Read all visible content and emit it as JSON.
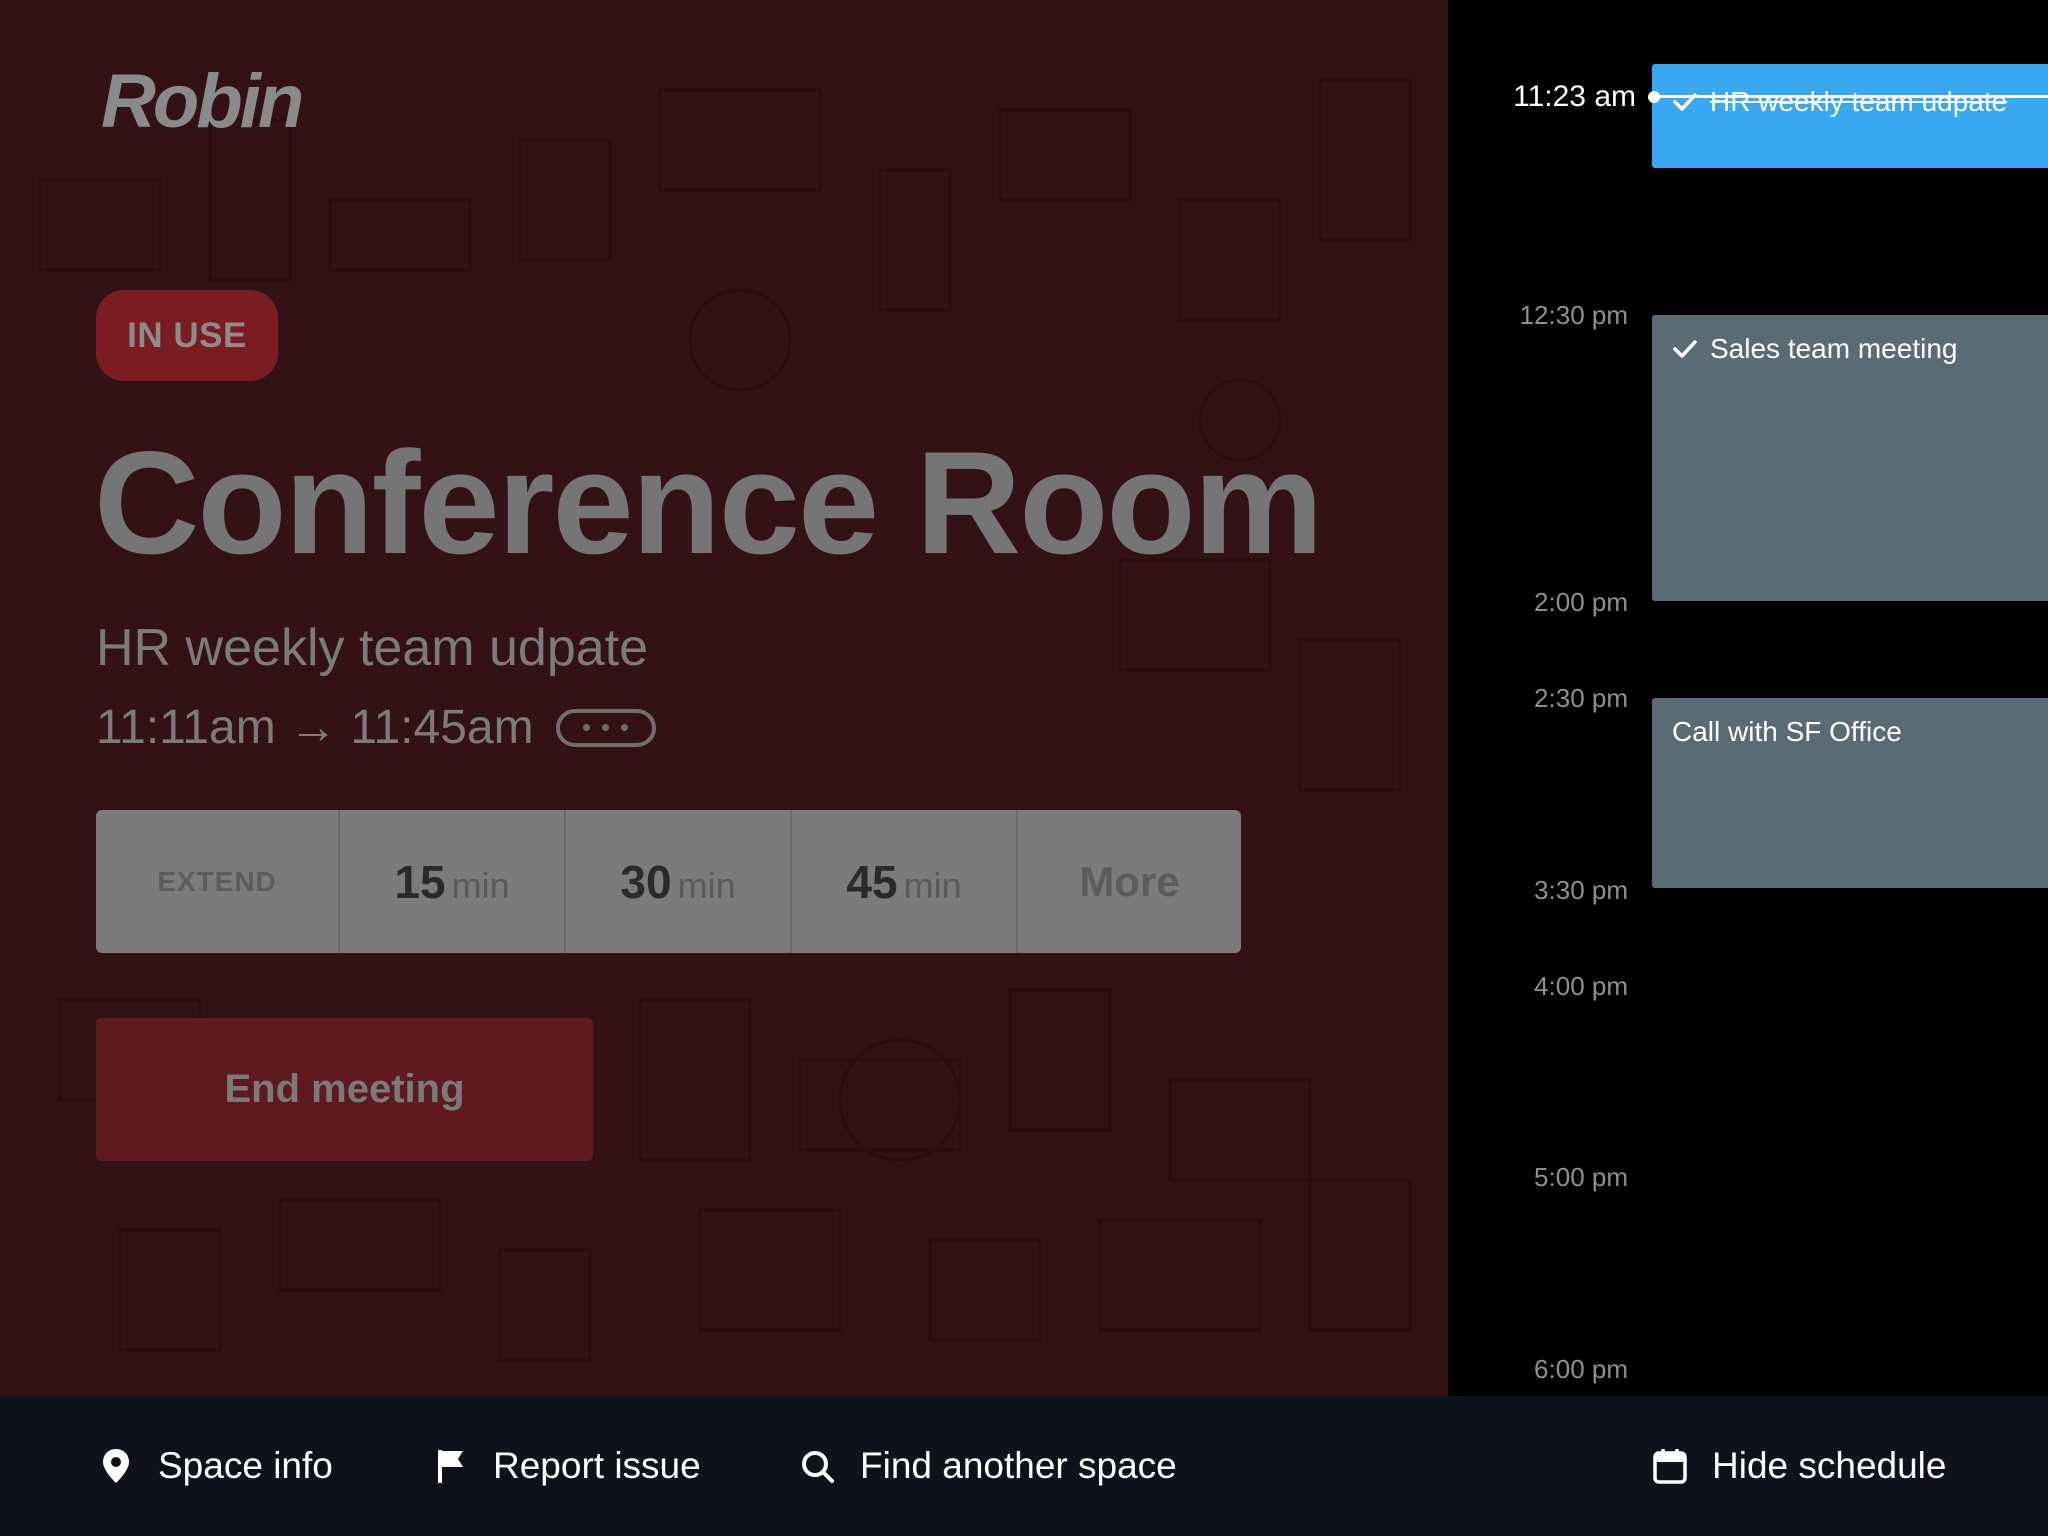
{
  "brand": {
    "logo_text": "Robin"
  },
  "room": {
    "status": "IN USE",
    "name": "Conference Room"
  },
  "current_meeting": {
    "title": "HR weekly team udpate",
    "time_range": "11:11am → 11:45am"
  },
  "extend": {
    "label": "EXTEND",
    "options": [
      {
        "num": "15",
        "unit": "min"
      },
      {
        "num": "30",
        "unit": "min"
      },
      {
        "num": "45",
        "unit": "min"
      }
    ],
    "more_label": "More"
  },
  "end_meeting_label": "End meeting",
  "schedule": {
    "now": "11:23 am",
    "time_labels": [
      "12:30 pm",
      "2:00 pm",
      "2:30 pm",
      "3:30 pm",
      "4:00 pm",
      "5:00 pm",
      "6:00 pm"
    ],
    "events": [
      {
        "title": "HR weekly team udpate",
        "checked": true,
        "status": "past"
      },
      {
        "title": "Sales team meeting",
        "checked": true,
        "status": "upcoming"
      },
      {
        "title": "Call with SF Office",
        "checked": false,
        "status": "upcoming"
      }
    ]
  },
  "bottom_bar": {
    "space_info": "Space info",
    "report_issue": "Report issue",
    "find_space": "Find another space",
    "hide_schedule": "Hide schedule"
  },
  "colors": {
    "left_bg": "#331216",
    "badge_bg": "#7a1c22",
    "end_button_bg": "#5e1a1f",
    "past_event": "#39a8f0",
    "event_grey": "#5b6b76",
    "bottom_bar": "#0f121a"
  }
}
